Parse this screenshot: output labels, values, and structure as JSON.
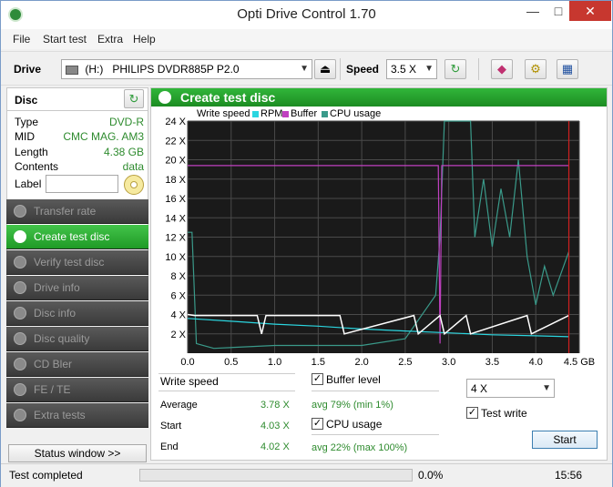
{
  "window": {
    "title": "Opti Drive Control 1.70"
  },
  "menu": [
    "File",
    "Start test",
    "Extra",
    "Help"
  ],
  "drivebar": {
    "drive_label": "Drive",
    "drive_letter": "(H:)",
    "drive_name": "PHILIPS DVDR885P P2.0",
    "speed_label": "Speed",
    "speed_value": "3.5 X"
  },
  "disc": {
    "header": "Disc",
    "fields": [
      {
        "key": "Type",
        "value": "DVD-R"
      },
      {
        "key": "MID",
        "value": "CMC MAG. AM3"
      },
      {
        "key": "Length",
        "value": "4.38 GB"
      },
      {
        "key": "Contents",
        "value": "data"
      }
    ],
    "label_key": "Label",
    "label_value": ""
  },
  "nav": [
    {
      "label": "Transfer rate",
      "active": false
    },
    {
      "label": "Create test disc",
      "active": true
    },
    {
      "label": "Verify test disc",
      "active": false
    },
    {
      "label": "Drive info",
      "active": false
    },
    {
      "label": "Disc info",
      "active": false
    },
    {
      "label": "Disc quality",
      "active": false
    },
    {
      "label": "CD Bler",
      "active": false
    },
    {
      "label": "FE / TE",
      "active": false
    },
    {
      "label": "Extra tests",
      "active": false
    }
  ],
  "status_window_label": "Status window >>",
  "panel": {
    "title": "Create test disc",
    "legend": [
      "Write speed",
      "RPM",
      "Buffer",
      "CPU usage"
    ],
    "write_speed_title": "Write speed",
    "average_key": "Average",
    "average_value": "3.78 X",
    "start_key": "Start",
    "start_value": "4.03 X",
    "end_key": "End",
    "end_value": "4.02 X",
    "buffer_level_label": "Buffer level",
    "buffer_level_checked": true,
    "buffer_stats": "avg 79% (min 1%)",
    "cpu_usage_label": "CPU usage",
    "cpu_usage_checked": true,
    "cpu_stats": "avg 22% (max 100%)",
    "speed_select": "4 X",
    "test_write_label": "Test write",
    "test_write_checked": true,
    "start_button": "Start"
  },
  "chart_data": {
    "type": "line",
    "xlabel": "GB",
    "ylabel": "",
    "x_ticks": [
      "0.0",
      "0.5",
      "1.0",
      "1.5",
      "2.0",
      "2.5",
      "3.0",
      "3.5",
      "4.0",
      "4.5 GB"
    ],
    "y_ticks": [
      "2 X",
      "4 X",
      "6 X",
      "8 X",
      "10 X",
      "12 X",
      "14 X",
      "16 X",
      "18 X",
      "20 X",
      "22 X",
      "24 X"
    ],
    "xlim": [
      0,
      4.5
    ],
    "ylim": [
      0,
      24
    ],
    "grid": true,
    "background": "#1a1a1a",
    "colors": {
      "write_speed": "#ffffff",
      "rpm": "#2bd6e0",
      "buffer": "#c040c0",
      "cpu": "#3a9a8a",
      "end_marker": "#d02020"
    },
    "series": [
      {
        "name": "Write speed",
        "x": [
          0.0,
          0.08,
          0.8,
          0.85,
          0.9,
          1.75,
          1.8,
          2.6,
          2.65,
          2.9,
          2.95,
          3.2,
          3.25,
          3.9,
          3.95,
          4.38
        ],
        "values": [
          4.0,
          3.9,
          3.9,
          2.0,
          3.9,
          3.9,
          2.0,
          3.9,
          2.0,
          3.9,
          2.0,
          3.9,
          2.0,
          3.9,
          2.0,
          3.9
        ]
      },
      {
        "name": "RPM",
        "x": [
          0.0,
          0.5,
          1.0,
          1.5,
          2.0,
          2.5,
          3.0,
          3.5,
          4.0,
          4.38
        ],
        "values": [
          3.6,
          3.3,
          3.0,
          2.8,
          2.5,
          2.3,
          2.1,
          1.9,
          1.8,
          1.7
        ]
      },
      {
        "name": "Buffer",
        "x": [
          0.0,
          0.02,
          2.88,
          2.9,
          2.92,
          4.38
        ],
        "values": [
          19.4,
          19.4,
          19.4,
          1.0,
          19.4,
          19.4
        ]
      },
      {
        "name": "CPU usage",
        "x": [
          0.0,
          0.05,
          0.1,
          0.3,
          1.0,
          2.0,
          2.5,
          2.85,
          2.9,
          2.95,
          3.0,
          3.05,
          3.25,
          3.3,
          3.4,
          3.5,
          3.6,
          3.7,
          3.8,
          3.9,
          4.0,
          4.1,
          4.2,
          4.38
        ],
        "values": [
          12.5,
          12.5,
          1.0,
          0.5,
          0.8,
          0.8,
          1.5,
          6.0,
          12.0,
          24.0,
          24.0,
          24.0,
          24.0,
          12.0,
          18.0,
          11.0,
          17.0,
          12.0,
          20.0,
          10.0,
          5.0,
          9.0,
          6.0,
          10.5
        ]
      }
    ]
  },
  "statusbar": {
    "text": "Test completed",
    "percent": "0.0%",
    "progress": 0.0,
    "time": "15:56"
  }
}
